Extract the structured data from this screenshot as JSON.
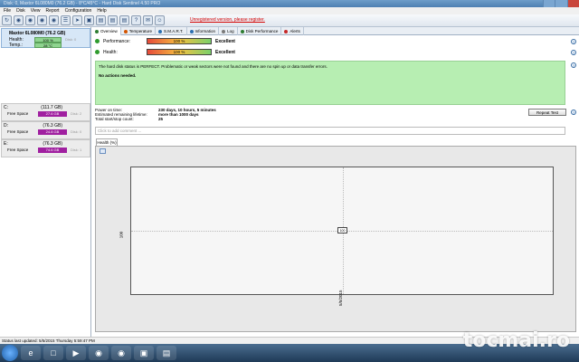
{
  "window": {
    "title": "Disk: 0, Maxtor 6L080M0 (76.2 GB) - 8°C/45°C - Hard Disk Sentinel 4.50 PRO"
  },
  "menu": [
    "File",
    "Disk",
    "View",
    "Report",
    "Configuration",
    "Help"
  ],
  "toolbar": {
    "warning": "Unregistered version, please register."
  },
  "sidebar": {
    "disk_name": "Maxtor 6L080M0 (76.2 GB)",
    "health_label": "Health:",
    "health_value": "100 %",
    "health_sub": "Disk: 0",
    "temp_label": "Temp.:",
    "temp_value": "28 °C",
    "volumes": [
      {
        "letter": "C:",
        "size": "(111.7 GB)",
        "free_label": "Free Space",
        "free": "27.6 GB",
        "disk": "Disk: 2"
      },
      {
        "letter": "D:",
        "size": "(76.3 GB)",
        "free_label": "Free Space",
        "free": "24.8 GB",
        "disk": "Disk: 0"
      },
      {
        "letter": "E:",
        "size": "(76.3 GB)",
        "free_label": "Free Space",
        "free": "74.6 GB",
        "disk": "Disk: 1"
      }
    ]
  },
  "tabs": [
    "Overview",
    "Temperature",
    "S.M.A.R.T.",
    "Information",
    "Log",
    "Disk Performance",
    "Alerts"
  ],
  "overview": {
    "performance_label": "Performance:",
    "performance_value": "100 %",
    "performance_text": "Excellent",
    "health_label": "Health:",
    "health_value": "100 %",
    "health_text": "Excellent",
    "status_message": "The hard disk status is PERFECT. Problematic or weak sectors were not found and there are no spin up or data transfer errors.",
    "actions": "No actions needed.",
    "power_on_label": "Power on time:",
    "power_on_value": "230 days, 10 hours, 5 minutes",
    "lifetime_label": "Estimated remaining lifetime:",
    "lifetime_value": "more than 1000 days",
    "startstop_label": "Total start/stop count:",
    "startstop_value": "25",
    "repeat_button": "Repeat Test",
    "comment_placeholder": "Click to add comment ...",
    "graph_tab": "Health (%)",
    "graph_point": "100",
    "y_axis_tick": "100",
    "x_axis_tick": "5/5/2015"
  },
  "chart_data": {
    "type": "line",
    "title": "",
    "xlabel": "",
    "ylabel": "",
    "series": [
      {
        "x": [
          "5/5/2015"
        ],
        "values": [
          100
        ]
      }
    ]
  },
  "statusbar": {
    "text": "Status last updated: 5/5/2015 Thursday 5:59:47 PM"
  },
  "taskbar": {
    "items": [
      "start-orb",
      "ie-icon",
      "folder-icon",
      "media-icon",
      "chrome-icon",
      "firefox-icon",
      "hds-icon",
      "paint-icon"
    ]
  },
  "watermark": "tocmai.ro"
}
